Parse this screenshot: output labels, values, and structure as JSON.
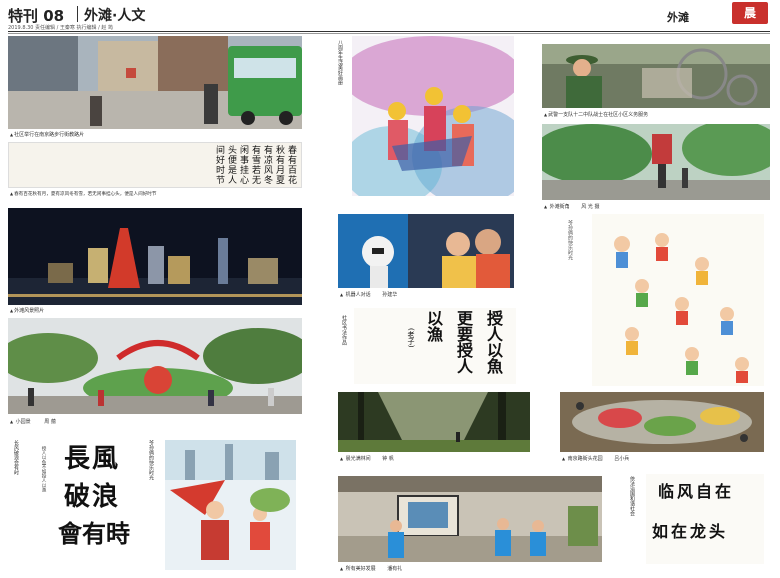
{
  "header": {
    "issue": "特刊 08",
    "section": "外滩·人文",
    "meta": "2019.8.30  责任编辑 / 王秦寒  执行编辑 / 赵 筠",
    "brand": "外滩",
    "logo_text": "晨"
  },
  "captions": {
    "c1": "社区举行在南京路步行街教路片",
    "c2": "春有百花秋有月，夏有凉风冬有雪，若无闲事挂心头，便是人间好时节",
    "c3": "外滩风景照片",
    "c4": "小园景",
    "c4b": "周 蕴",
    "c5": "长风破浪会有时",
    "c6": "机器人对话",
    "c6b": "孙建华",
    "c7": "晨光满林间",
    "c7b": "钟 帆",
    "c8": "所有美好发展",
    "c8b": "潘有礼",
    "c9": "武警一支队十二中队战士在社区小区义务服务",
    "c10": "外滩街角",
    "c10b": "风 光 摄",
    "c11": "南京路街头花园",
    "c11b": "吕小兵",
    "v1": "八周年生活美好画册",
    "v2": "授人以鱼不如授人以渔",
    "v3": "长风破浪会有时",
    "v4": "社区书法作品",
    "v5": "爷孙俩的快乐时光",
    "v6": "依法治国和谐社会"
  },
  "calligraphy": {
    "banner": "春有百花秋有月夏有凉风冬有雪若无闲事挂心头便是人间好时节",
    "yu_1": "授人以魚",
    "yu_2": "更要授人",
    "yu_3": "以漁",
    "yu_sig": "(老子)",
    "changfeng_1": "長風",
    "changfeng_2": "破浪",
    "changfeng_3": "會有時",
    "right_1": "临风自在",
    "right_2": "如在龙头"
  },
  "colors": {
    "logo": "#c9302c",
    "header_text": "#222222"
  }
}
